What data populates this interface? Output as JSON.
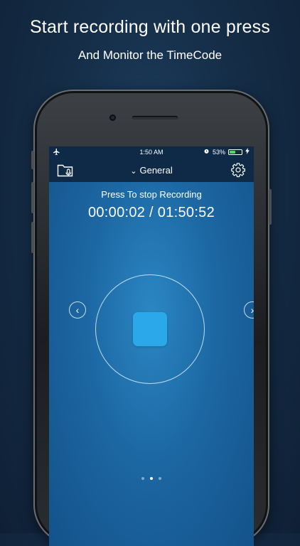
{
  "headline": {
    "title": "Start recording with one press",
    "subtitle": "And Monitor the TimeCode"
  },
  "statusbar": {
    "time": "1:50 AM",
    "battery_percent": "53%",
    "battery_level": 0.53,
    "icons": [
      "airplane-icon",
      "alarm-icon",
      "battery-icon",
      "charging-icon"
    ]
  },
  "navbar": {
    "title": "General",
    "left_icon": "folder-mic-icon",
    "right_icon": "gear-icon"
  },
  "recorder": {
    "prompt": "Press To stop Recording",
    "timecode": "00:00:02 / 01:50:52",
    "state": "recording"
  },
  "pager": {
    "pages": 3,
    "active_index": 1
  },
  "colors": {
    "accent": "#2aa8ea",
    "navbar": "#0e2a47",
    "screen_bg": "#1c67a3"
  }
}
